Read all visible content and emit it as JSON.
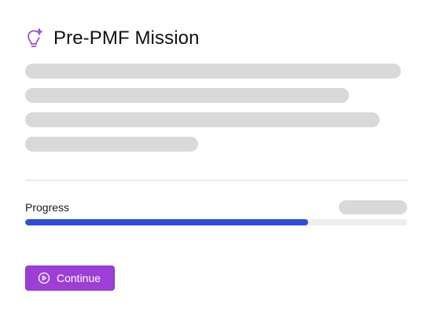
{
  "header": {
    "title": "Pre-PMF Mission",
    "icon": "lightbulb-sparkle-icon"
  },
  "progress": {
    "label": "Progress",
    "fraction": 0.74
  },
  "actions": {
    "continue_label": "Continue",
    "continue_icon": "play-circle-icon"
  },
  "colors": {
    "accent_purple": "#9b3fd6",
    "icon_purple": "#9b4fd9",
    "progress_blue": "#2f4fd8",
    "skeleton_gray": "#d9d9d9"
  }
}
